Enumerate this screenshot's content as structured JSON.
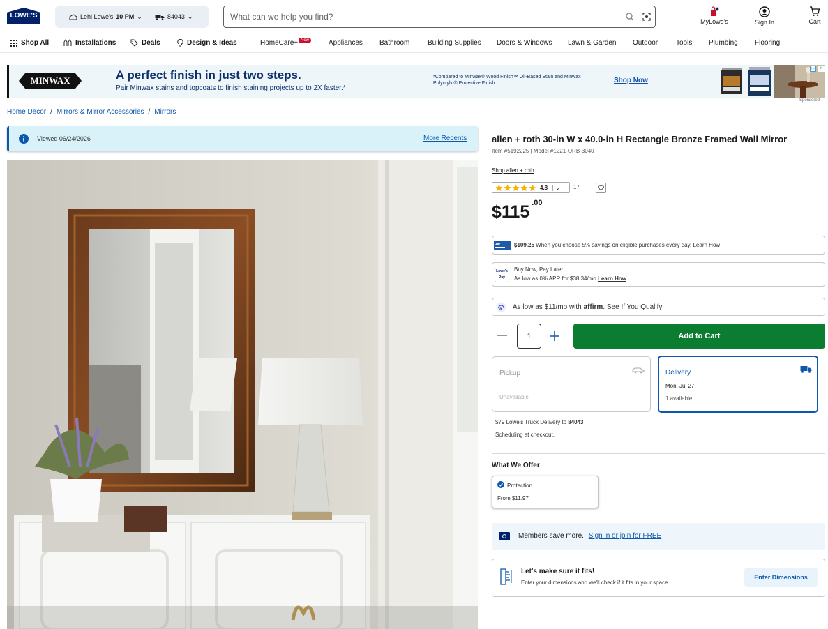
{
  "header": {
    "logo": "LOWE'S",
    "store_prefix": "Lehi Lowe's",
    "store_hours": "10 PM",
    "zip": "84043",
    "search_placeholder": "What can we help you find?",
    "mylowes": "MyLowe's",
    "sign_in": "Sign In",
    "cart": "Cart"
  },
  "nav": {
    "shop_all": "Shop All",
    "installations": "Installations",
    "deals": "Deals",
    "design_ideas": "Design & Ideas",
    "items": [
      "HomeCare+",
      "Appliances",
      "Bathroom",
      "Building Supplies",
      "Doors & Windows",
      "Lawn & Garden",
      "Outdoor",
      "Tools",
      "Plumbing",
      "Flooring"
    ],
    "new_badge": "New"
  },
  "banner": {
    "brand": "MINWAX",
    "headline": "A perfect finish in just two steps.",
    "subline": "Pair Minwax stains and topcoats to finish staining projects up to 2X faster.*",
    "fine_print": "*Compared to Minwax® Wood Finish™ Oil-Based Stain and Minwax Polycrylic® Protective Finish",
    "cta": "Shop Now",
    "sponsored": "Sponsored"
  },
  "breadcrumb": [
    "Home Decor",
    "Mirrors & Mirror Accessories",
    "Mirrors"
  ],
  "viewed": {
    "text": "Viewed 06/24/2026",
    "link": "More Recents"
  },
  "product": {
    "title": "allen + roth 30-in W x 40.0-in H Rectangle Bronze Framed Wall Mirror",
    "item_model": "Item #5192225 | Model #1221-ORB-3040",
    "shop_brand": "Shop allen + roth",
    "rating": "4.8",
    "rating_value": 4.8,
    "review_count": "17",
    "price_dollars": "$115",
    "price_cents": ".00"
  },
  "offers": {
    "card_price": "$109.25",
    "card_text": "When you choose 5% savings on eligible purchases every day.",
    "card_link": "Learn How",
    "pay_label": "Lowe's Pay",
    "bnpl_title": "Buy Now, Pay Later",
    "bnpl_text": "As low as 0% APR for $38.34/mo",
    "bnpl_link": "Learn How",
    "affirm_text": "As low as $11/mo with",
    "affirm_brand": "affirm",
    "affirm_link": "See If You Qualify"
  },
  "purchase": {
    "quantity": "1",
    "add_to_cart": "Add to Cart",
    "pickup_label": "Pickup",
    "pickup_status": "Unavailable",
    "delivery_label": "Delivery",
    "delivery_date": "Mon, Jul 27",
    "delivery_avail": "1 available",
    "truck_prefix": "$79 Lowe's Truck Delivery to",
    "truck_zip": "84043",
    "scheduling": "Scheduling at checkout."
  },
  "what_we_offer": {
    "heading": "What We Offer",
    "protection": "Protection",
    "protection_price": "From $11.97"
  },
  "members": {
    "text": "Members save more.",
    "link": "Sign in or join for FREE"
  },
  "fits": {
    "title": "Let's make sure it fits!",
    "text": "Enter your dimensions and we'll check if it fits in your space.",
    "button": "Enter Dimensions"
  },
  "colors": {
    "brand_blue": "#012169",
    "link_blue": "#0d58ab",
    "cart_green": "#0b7d30",
    "star": "#f5b301"
  }
}
